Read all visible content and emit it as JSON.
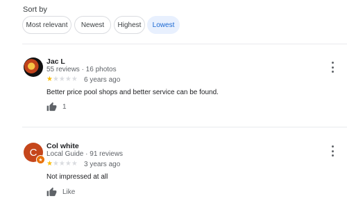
{
  "sort": {
    "label": "Sort by",
    "options": [
      "Most relevant",
      "Newest",
      "Highest",
      "Lowest"
    ],
    "selected": "Lowest"
  },
  "reviews": [
    {
      "name": "Jac L",
      "meta": "55 reviews · 16 photos",
      "rating": 1,
      "date": "6 years ago",
      "text": "Better price pool shops and better service can be found.",
      "like_label": "1"
    },
    {
      "name": "Col white",
      "avatar_letter": "C",
      "meta": "Local Guide · 91 reviews",
      "rating": 1,
      "date": "3 years ago",
      "text": "Not impressed at all",
      "like_label": "Like"
    }
  ],
  "colors": {
    "accent": "#1967d2",
    "chip_active_bg": "#e8f0fe",
    "star": "#fbbc04",
    "avatar_c": "#c5461b"
  },
  "icons": [
    "thumbs-up-icon",
    "more-vert-icon",
    "local-guide-badge-icon",
    "star-icon"
  ]
}
